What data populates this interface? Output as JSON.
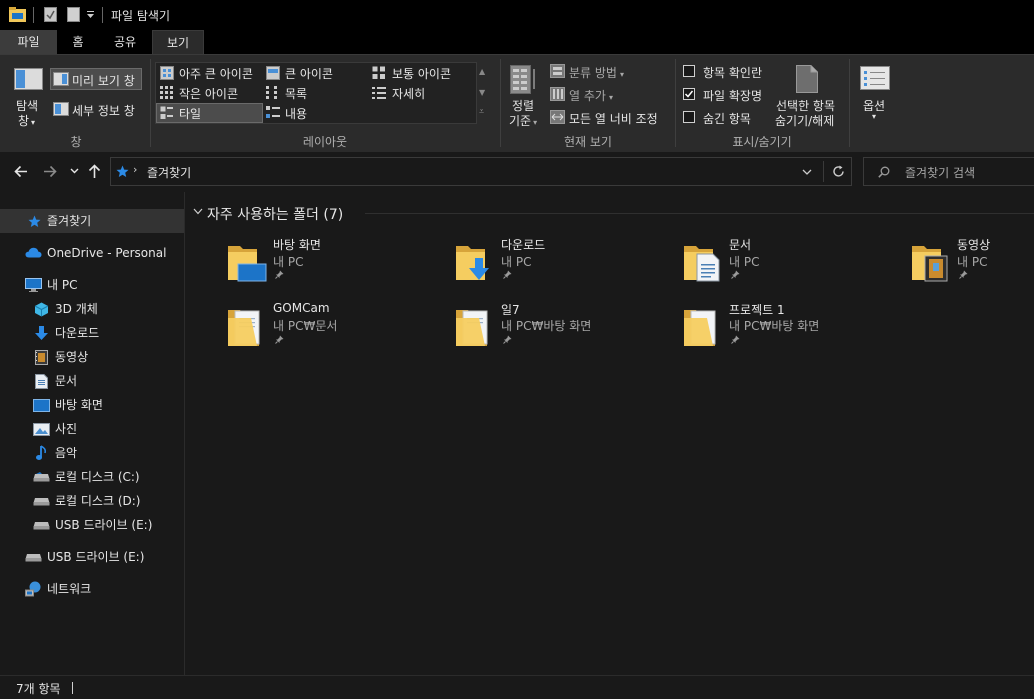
{
  "window": {
    "title": "파일 탐색기"
  },
  "tabs": [
    "파일",
    "홈",
    "공유",
    "보기"
  ],
  "ribbon": {
    "pane": {
      "nav_pane_label": "탐색\n창",
      "nav_pane_line1": "탐색",
      "nav_pane_line2": "창",
      "preview": "미리 보기 창",
      "details": "세부 정보 창",
      "group": "창"
    },
    "layout": {
      "items": [
        "아주 큰 아이콘",
        "큰 아이콘",
        "보통 아이콘",
        "작은 아이콘",
        "목록",
        "자세히",
        "타일",
        "내용"
      ],
      "group": "레이아웃"
    },
    "current_view": {
      "sort_line1": "정렬",
      "sort_line2": "기준",
      "group_by": "분류 방법",
      "add_columns": "열 추가",
      "size_all_columns": "모든 열 너비 조정",
      "group": "현재 보기"
    },
    "show_hide": {
      "item_check_boxes": "항목 확인란",
      "file_name_extensions": "파일 확장명",
      "hidden_items": "숨긴 항목",
      "hide_selected_line1": "선택한 항목",
      "hide_selected_line2": "숨기기/해제",
      "group": "표시/숨기기",
      "checks": {
        "item_check_boxes": false,
        "file_name_extensions": true,
        "hidden_items": false
      }
    },
    "options": {
      "label": "옵션"
    }
  },
  "address": {
    "location": "즐겨찾기"
  },
  "search": {
    "placeholder": "즐겨찾기 검색"
  },
  "nav": {
    "quick_access": "즐겨찾기",
    "onedrive": "OneDrive - Personal",
    "this_pc": "내 PC",
    "pc_children": [
      "3D 개체",
      "다운로드",
      "동영상",
      "문서",
      "바탕 화면",
      "사진",
      "음악",
      "로컬 디스크 (C:)",
      "로컬 디스크 (D:)",
      "USB 드라이브 (E:)"
    ],
    "usb": "USB 드라이브 (E:)",
    "network": "네트워크"
  },
  "section": {
    "title": "자주 사용하는 폴더 (7)"
  },
  "folders": [
    {
      "name": "바탕 화면",
      "path": "내 PC",
      "icon": "desktop-folder-icon"
    },
    {
      "name": "다운로드",
      "path": "내 PC",
      "icon": "downloads-folder-icon"
    },
    {
      "name": "문서",
      "path": "내 PC",
      "icon": "documents-folder-icon"
    },
    {
      "name": "동영상",
      "path": "내 PC",
      "icon": "videos-folder-icon"
    },
    {
      "name": "GOMCam",
      "path": "내 PC₩문서",
      "icon": "folder-icon"
    },
    {
      "name": "일7",
      "path": "내 PC₩바탕 화면",
      "icon": "folder-icon"
    },
    {
      "name": "프로젝트 1",
      "path": "내 PC₩바탕 화면",
      "icon": "folder-icon"
    }
  ],
  "status": {
    "count": "7개 항목"
  },
  "colors": {
    "accent": "#0078d7",
    "folder": "#f0c75a",
    "selected_tab": "#2b2b2b",
    "ribbon": "#2b2b2b",
    "bg": "#191919"
  }
}
